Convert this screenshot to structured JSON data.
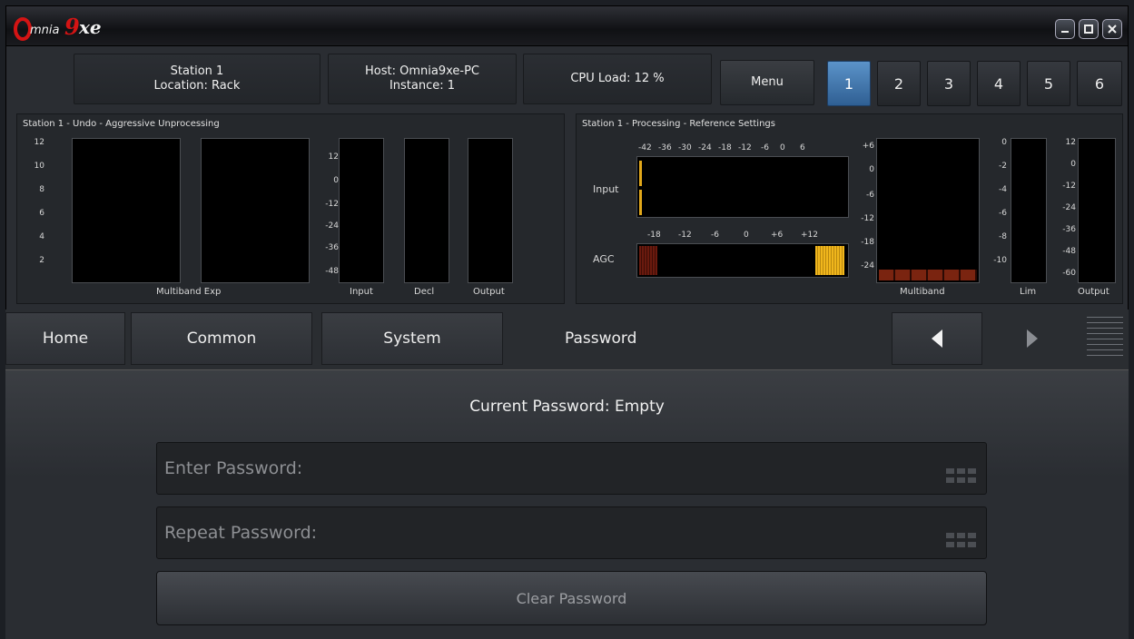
{
  "header": {
    "station_line1": "Station 1",
    "station_line2": "Location: Rack",
    "host_line1": "Host: Omnia9xe-PC",
    "host_line2": "Instance: 1",
    "cpu_load": "CPU Load: 12 %",
    "menu_label": "Menu",
    "presets": [
      "1",
      "2",
      "3",
      "4",
      "5",
      "6"
    ],
    "active_preset": "1"
  },
  "left_panel": {
    "title": "Station 1 - Undo - Aggressive Unprocessing",
    "scale_a": [
      "12",
      "10",
      "8",
      "6",
      "4",
      "2"
    ],
    "scale_b": [
      "12",
      "0",
      "-12",
      "-24",
      "-36",
      "-48"
    ],
    "labels": {
      "multiband_exp": "Multiband Exp",
      "input": "Input",
      "decl": "Decl",
      "output": "Output"
    }
  },
  "right_panel": {
    "title": "Station 1 - Processing - Reference Settings",
    "input_label": "Input",
    "agc_label": "AGC",
    "input_scale": [
      "-42",
      "-36",
      "-30",
      "-24",
      "-18",
      "-12",
      "-6",
      "0",
      "6"
    ],
    "agc_scale": [
      "-18",
      "-12",
      "-6",
      "0",
      "+6",
      "+12"
    ],
    "multiband_scale": [
      "+6",
      "0",
      "-6",
      "-12",
      "-18",
      "-24"
    ],
    "lim_scale": [
      "0",
      "-2",
      "-4",
      "-6",
      "-8",
      "-10"
    ],
    "output_scale": [
      "12",
      "0",
      "-12",
      "-24",
      "-36",
      "-48",
      "-60"
    ],
    "labels": {
      "multiband": "Multiband",
      "lim": "Lim",
      "output": "Output"
    }
  },
  "nav": {
    "home": "Home",
    "common": "Common",
    "system": "System",
    "password": "Password"
  },
  "password": {
    "current": "Current Password: Empty",
    "enter_placeholder": "Enter Password:",
    "repeat_placeholder": "Repeat Password:",
    "clear_label": "Clear Password"
  },
  "colors": {
    "accent": "#4a86c0",
    "meter_amber": "#e2a81a",
    "meter_red": "#6a1a0e"
  }
}
